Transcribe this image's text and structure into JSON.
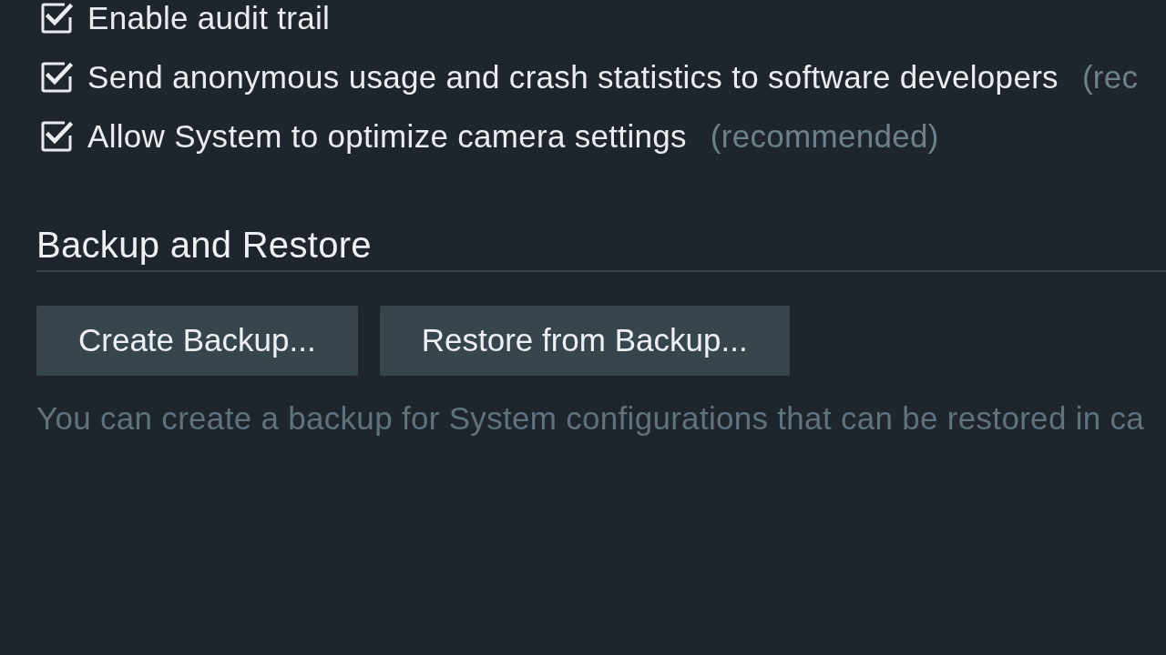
{
  "settings": [
    {
      "label": "Enable audit trail",
      "checked": true
    },
    {
      "label": "Send anonymous usage and crash statistics to software developers",
      "note": "(rec",
      "checked": true
    },
    {
      "label": "Allow System to optimize camera settings",
      "note": "(recommended)",
      "checked": true
    }
  ],
  "backup_section": {
    "title": "Backup and Restore",
    "buttons": [
      "Create Backup...",
      "Restore from Backup..."
    ],
    "description": "You can create a backup for System configurations that can be restored in ca"
  }
}
